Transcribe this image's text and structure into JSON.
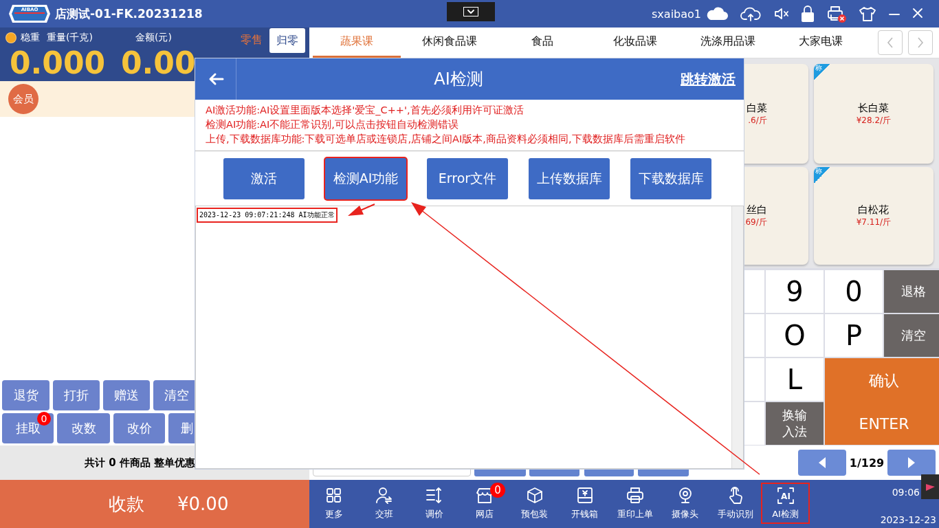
{
  "window": {
    "title": "店测试-01-FK.20231218",
    "logo_text": "AIBAO",
    "user": "sxaibao1"
  },
  "scale": {
    "status": "稳重",
    "weight_label": "重量(千克)",
    "amount_label": "金额(元)",
    "mode": "零售",
    "zero_button": "归零",
    "weight": "0.000",
    "amount": "0.00"
  },
  "member_button": "会员",
  "action_rows": [
    [
      {
        "label": "退货"
      },
      {
        "label": "打折"
      },
      {
        "label": "赠送"
      },
      {
        "label": "清空"
      }
    ],
    [
      {
        "label": "挂取",
        "badge": "0"
      },
      {
        "label": "改数"
      },
      {
        "label": "改价"
      },
      {
        "label": "删"
      }
    ]
  ],
  "summary": "共计 0 件商品 整单优惠",
  "pay": {
    "label": "收款",
    "amount": "¥0.00"
  },
  "tabs": [
    {
      "label": "蔬果课",
      "selected": true
    },
    {
      "label": "休闲食品课",
      "selected": false
    },
    {
      "label": "食品",
      "selected": false
    },
    {
      "label": "化妆品课",
      "selected": false
    },
    {
      "label": "洗涤用品课",
      "selected": false
    },
    {
      "label": "大家电课",
      "selected": false
    }
  ],
  "products": [
    {
      "name": "白菜",
      "price": ".6/斤"
    },
    {
      "name": "长白菜",
      "price": "¥28.2/斤",
      "badge": "称"
    },
    {
      "name": "丝白",
      "price": ".69/斤"
    },
    {
      "name": "白松花",
      "price": "¥7.11/斤",
      "badge": "称"
    }
  ],
  "keypad": [
    {
      "kind": "blank"
    },
    {
      "kind": "char",
      "label": "9"
    },
    {
      "kind": "char",
      "label": "0"
    },
    {
      "kind": "func",
      "label": "退格"
    },
    {
      "kind": "blank"
    },
    {
      "kind": "char",
      "label": "O"
    },
    {
      "kind": "char",
      "label": "P"
    },
    {
      "kind": "func",
      "label": "清空"
    },
    {
      "kind": "blank"
    },
    {
      "kind": "char",
      "label": "L"
    },
    {
      "kind": "enter",
      "label": "确认",
      "sublabel": "ENTER"
    },
    {
      "kind": "blank"
    },
    {
      "kind": "func",
      "label": "换输入法"
    }
  ],
  "pager": {
    "page": "1/129"
  },
  "dialog": {
    "title": "AI检测",
    "link": "跳转激活",
    "notes": [
      "AI激活功能:AI设置里面版本选择'爱宝_C++',首先必须利用许可证激活",
      "检测AI功能:AI不能正常识别,可以点击按钮自动检测错误",
      "上传,下载数据库功能:下载可选单店或连锁店,店铺之间AI版本,商品资料必须相同,下载数据库后需重启软件"
    ],
    "buttons": [
      {
        "label": "激活",
        "highlighted": false
      },
      {
        "label": "检测AI功能",
        "highlighted": true
      },
      {
        "label": "Error文件",
        "highlighted": false
      },
      {
        "label": "上传数据库",
        "highlighted": false
      },
      {
        "label": "下载数据库",
        "highlighted": false
      }
    ],
    "log": [
      {
        "text": "2023-12-23 09:07:21:248 AI功能正常",
        "highlighted": true
      }
    ]
  },
  "toolbar": [
    {
      "label": "更多",
      "highlighted": false
    },
    {
      "label": "交班",
      "highlighted": false
    },
    {
      "label": "调价",
      "highlighted": false
    },
    {
      "label": "网店",
      "highlighted": false,
      "badge": "0"
    },
    {
      "label": "预包装",
      "highlighted": false
    },
    {
      "label": "开钱箱",
      "highlighted": false
    },
    {
      "label": "重印上单",
      "highlighted": false
    },
    {
      "label": "摄像头",
      "highlighted": false
    },
    {
      "label": "手动识别",
      "highlighted": false
    },
    {
      "label": "AI检测",
      "highlighted": true,
      "icon_text": "AI"
    }
  ],
  "clock": {
    "time": "09:06",
    "date": "2023-12-23"
  }
}
